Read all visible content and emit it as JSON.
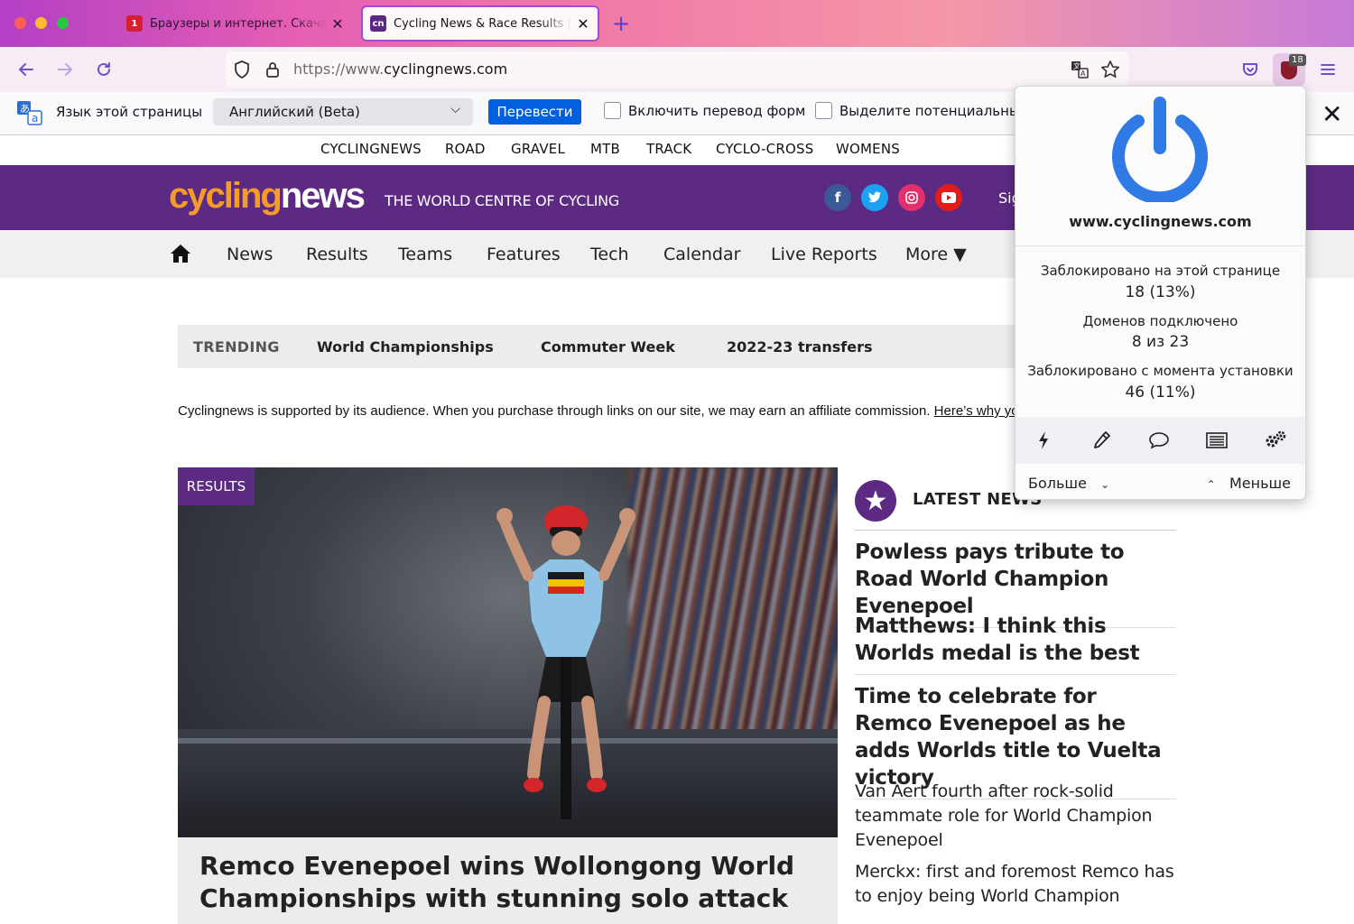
{
  "tabs": [
    {
      "title": "Браузеры и интернет. Скачать бесплатно"
    },
    {
      "title": "Cycling News & Race Results | Cyclingnews"
    }
  ],
  "url": {
    "scheme": "https://www.",
    "host": "cyclingnews.com"
  },
  "ublock_badge": "18",
  "translation": {
    "page_lang_label": "Язык этой страницы",
    "selected_lang": "Английский (Beta)",
    "translate_button": "Перевести",
    "forms_option": "Включить перевод форм",
    "highlight_option": "Выделите потенциальные"
  },
  "site_links": [
    "CYCLINGNEWS",
    "ROAD",
    "GRAVEL",
    "MTB",
    "TRACK",
    "CYCLO-CROSS",
    "WOMENS"
  ],
  "banner": {
    "logo_part1": "cycling",
    "logo_part2": "news",
    "tagline": "THE WORLD CENTRE OF CYCLING",
    "signin": "Sign in"
  },
  "main_nav": [
    "News",
    "Results",
    "Teams",
    "Features",
    "Tech",
    "Calendar",
    "Live Reports",
    "More ▼"
  ],
  "trending": {
    "label": "TRENDING",
    "items": [
      "World Championships",
      "Commuter Week",
      "2022-23 transfers"
    ]
  },
  "affiliate": {
    "text": "Cyclingnews is supported by its audience. When you purchase through links on our site, we may earn an affiliate commission. ",
    "link": "Here’s why you can trust us."
  },
  "hero": {
    "badge": "RESULTS",
    "title": "Remco Evenepoel wins Wollongong World Championships with stunning solo attack"
  },
  "latest": {
    "title": "LATEST NEWS",
    "items": [
      "Powless pays tribute to Road World Champion Evenepoel",
      "Matthews: I think this Worlds medal is the best",
      "Time to celebrate for Remco Evenepoel as he adds Worlds title to Vuelta victory",
      "Van Aert fourth after rock-solid teammate role for World Champion Evenepoel",
      "Merckx: first and foremost Remco has to enjoy being World Champion"
    ]
  },
  "popup": {
    "host": "www.cyclingnews.com",
    "stats": [
      {
        "label": "Заблокировано на этой странице",
        "value": "18 (13%)"
      },
      {
        "label": "Доменов подключено",
        "value": "8 из 23"
      },
      {
        "label": "Заблокировано с момента установки",
        "value": "46 (11%)"
      }
    ],
    "more": "Больше",
    "less": "Меньше"
  },
  "colors": {
    "site_purple": "#5c2a82",
    "logo_orange": "#f49b2a",
    "power_blue": "#2f7ae5",
    "translate_blue": "#0060df"
  }
}
